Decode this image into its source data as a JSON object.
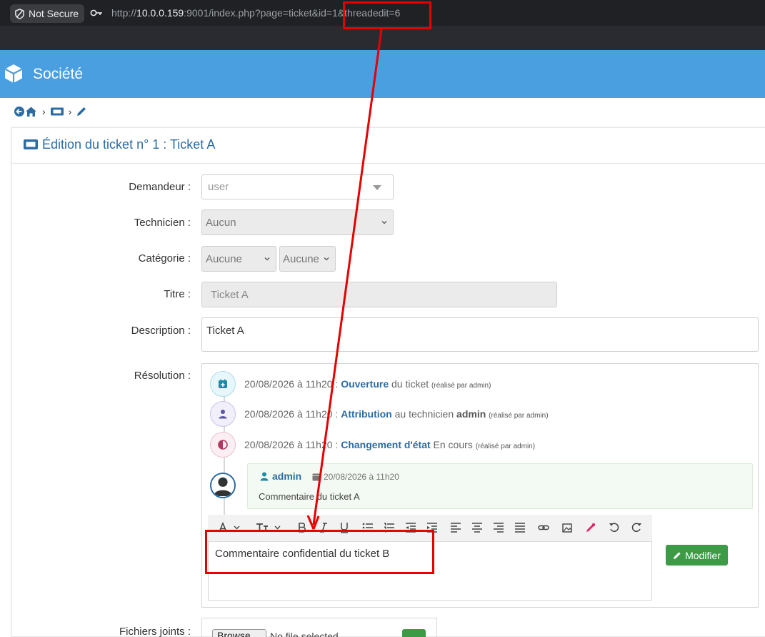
{
  "browser": {
    "security_label": "Not Secure",
    "url_prefix": "http://",
    "url_host": "10.0.0.159",
    "url_rest": ":9001/index.php?page=ticket&id=1&threadedit=6"
  },
  "app": {
    "title": "Société"
  },
  "card": {
    "title": "Édition du ticket n° 1 : Ticket A"
  },
  "form": {
    "demandeur_label": "Demandeur :",
    "demandeur_placeholder": "user",
    "technicien_label": "Technicien :",
    "technicien_value": "Aucun",
    "categorie_label": "Catégorie :",
    "categorie_value": "Aucune",
    "sous_categorie_value": "Aucune",
    "titre_label": "Titre :",
    "titre_value": "Ticket A",
    "description_label": "Description :",
    "description_value": "Ticket A",
    "resolution_label": "Résolution :",
    "fichiers_label": "Fichiers joints :"
  },
  "timeline": [
    {
      "date": "20/08/2026 à 11h20 :",
      "action": "Ouverture",
      "rest": "du ticket",
      "strong": "",
      "by": "(réalisé par admin)"
    },
    {
      "date": "20/08/2026 à 11h20 :",
      "action": "Attribution",
      "rest": "au technicien",
      "strong": "admin",
      "by": "(réalisé par admin)"
    },
    {
      "date": "20/08/2026 à 11h20 :",
      "action": "Changement d'état",
      "rest": "En cours",
      "strong": "",
      "by": "(réalisé par admin)"
    }
  ],
  "comment": {
    "author": "admin",
    "date": "20/08/2026 à 11h20",
    "text": "Commentaire du ticket A"
  },
  "editor": {
    "content": "Commentaire confidential du ticket B",
    "modify_label": "Modifier"
  },
  "files": {
    "browse_label": "Browse...",
    "no_file": "No file selected."
  },
  "annotation": {
    "color": "#e60000"
  }
}
